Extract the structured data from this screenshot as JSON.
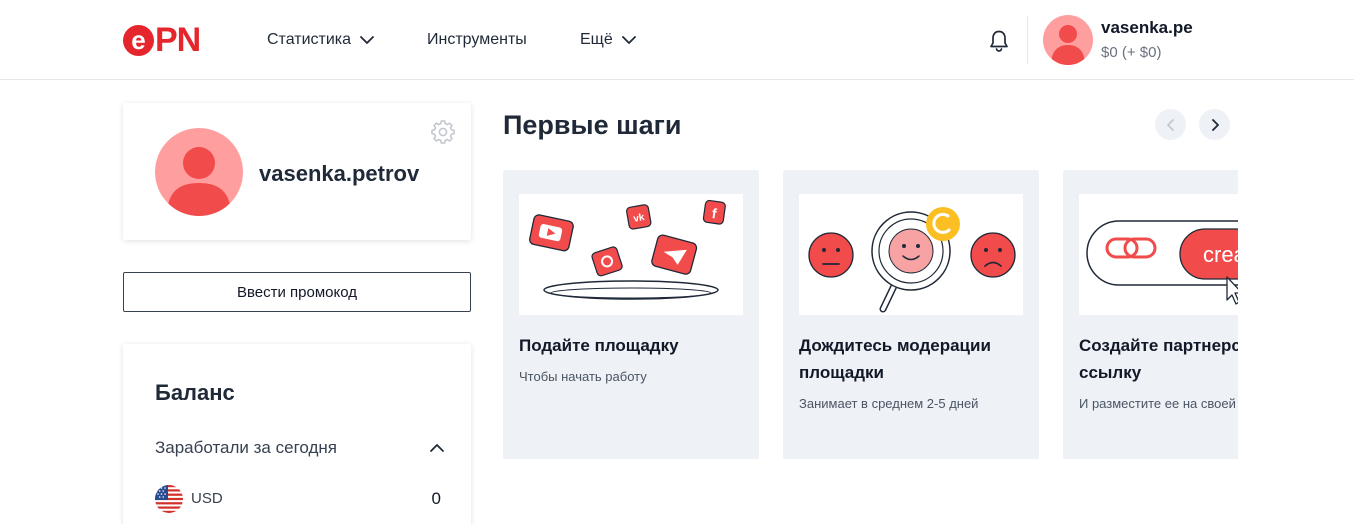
{
  "header": {
    "logo": {
      "e": "e",
      "text": "PN"
    },
    "nav": [
      {
        "label": "Статистика",
        "has_dropdown": true
      },
      {
        "label": "Инструменты",
        "has_dropdown": false
      },
      {
        "label": "Ещё",
        "has_dropdown": true
      }
    ],
    "user": {
      "name": "vasenka.pe",
      "balance": "$0 (+ $0)"
    }
  },
  "profile": {
    "name": "vasenka.petrov"
  },
  "promo_button": "Ввести промокод",
  "balance": {
    "title": "Баланс",
    "earned_today_label": "Заработали за сегодня",
    "currencies": [
      {
        "code": "USD",
        "value": "0"
      }
    ]
  },
  "first_steps": {
    "title": "Первые шаги",
    "cards": [
      {
        "title": "Подайте площадку",
        "subtitle": "Чтобы начать работу"
      },
      {
        "title": "Дождитесь модерации площадки",
        "subtitle": "Занимает в среднем 2-5 дней"
      },
      {
        "title": "Создайте партнерскую ссылку",
        "subtitle": "И разместите ее на своей площадке",
        "button_text": "create"
      }
    ]
  },
  "colors": {
    "brand_red": "#e5262c",
    "avatar_bg": "#ff9e9e",
    "card_bg": "#eef1f5",
    "text_dark": "#1f2937",
    "text_muted": "#6b7280"
  }
}
